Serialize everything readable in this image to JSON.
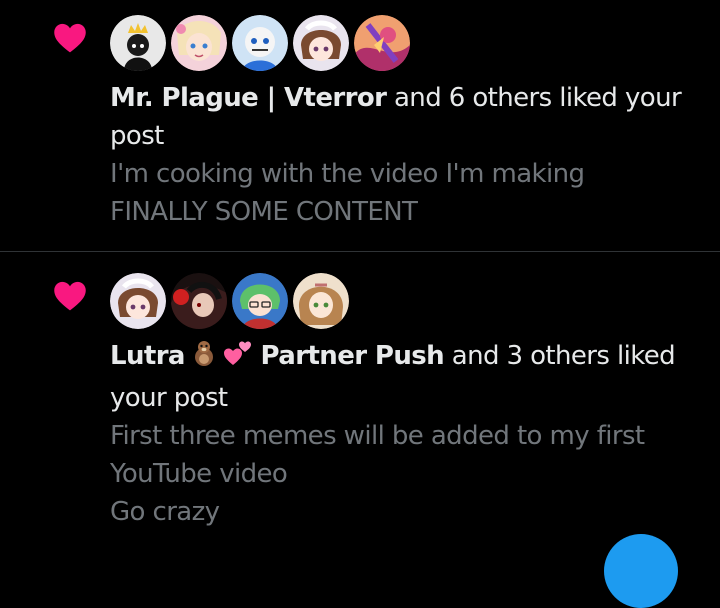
{
  "notifications": [
    {
      "type": "like",
      "icon": "heart-icon",
      "icon_color": "#f91880",
      "avatars": [
        "avatar-1",
        "avatar-2",
        "avatar-3",
        "avatar-4",
        "avatar-5"
      ],
      "actor_name": "Mr. Plague | Vterror",
      "action_text": " and 6 others liked your post",
      "post_lines": [
        "I'm cooking with the video I'm making",
        "FINALLY SOME CONTENT"
      ]
    },
    {
      "type": "like",
      "icon": "heart-icon",
      "icon_color": "#f91880",
      "avatars": [
        "avatar-1",
        "avatar-2",
        "avatar-3",
        "avatar-4"
      ],
      "actor_name_part1": "Lutra",
      "actor_emojis": [
        "otter-emoji",
        "two-hearts-emoji"
      ],
      "actor_name_part2": "Partner Push",
      "action_text": " and 3 others liked your post",
      "post_lines": [
        "First three memes will be added to my first",
        "YouTube video",
        "Go crazy"
      ]
    }
  ],
  "colors": {
    "background": "#000000",
    "primary_text": "#e7e9ea",
    "secondary_text": "#71767b",
    "divider": "#2f3336",
    "like_pink": "#f91880",
    "accent_blue": "#1d9bf0"
  }
}
